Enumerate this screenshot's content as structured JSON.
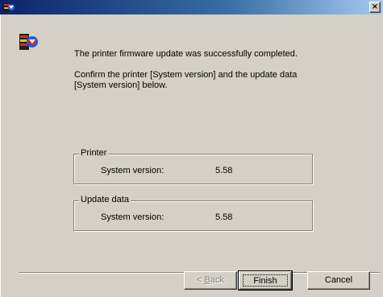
{
  "window": {
    "title": "",
    "close_label": "×"
  },
  "message": {
    "line1": "The printer firmware update was successfully completed.",
    "line2": "Confirm the printer [System version] and the update data [System version] below."
  },
  "printer": {
    "legend": "Printer",
    "label": "System version:",
    "value": "5.58"
  },
  "update_data": {
    "legend": "Update data",
    "label": "System version:",
    "value": "5.58"
  },
  "buttons": {
    "back_prefix": "< ",
    "back_accel": "B",
    "back_rest": "ack",
    "finish": "Finish",
    "cancel": "Cancel"
  },
  "icons": {
    "title": "printer-wizard-icon",
    "app": "printer-update-icon"
  },
  "colors": {
    "title_bar": "#0a246a",
    "face": "#d4d0c8"
  }
}
